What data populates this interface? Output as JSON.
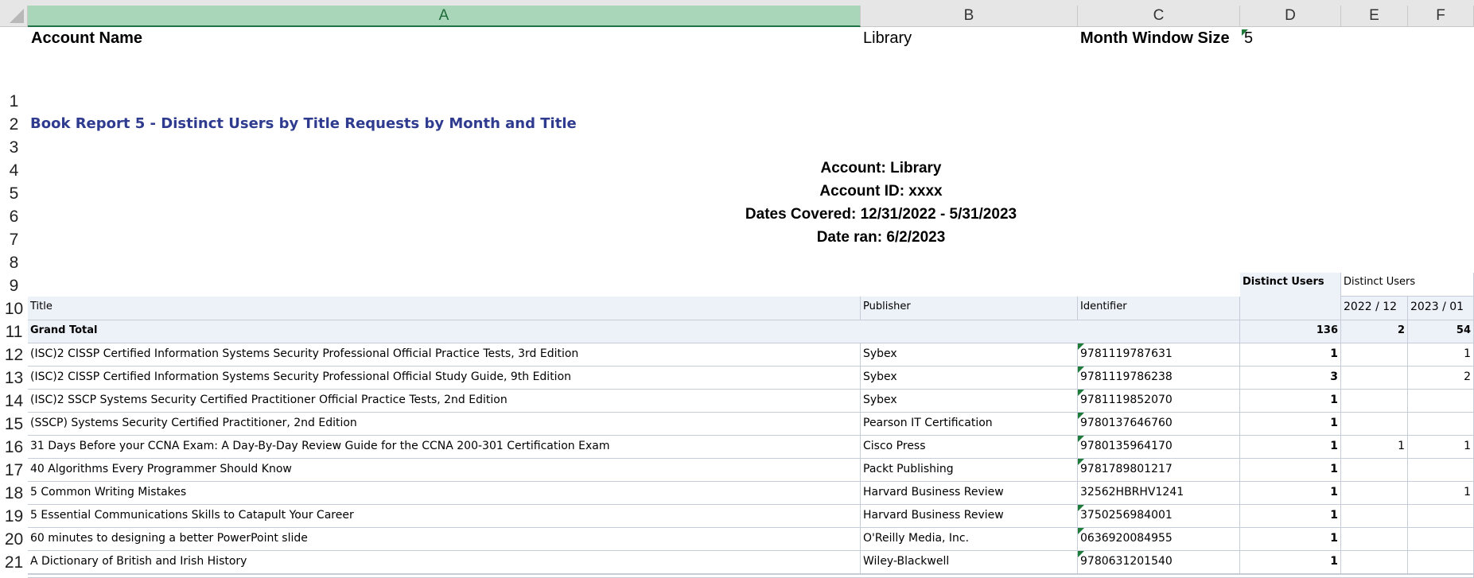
{
  "columns": [
    "A",
    "B",
    "C",
    "D",
    "E",
    "F"
  ],
  "rows": [
    "1",
    "2",
    "3",
    "4",
    "5",
    "6",
    "7",
    "8",
    "9",
    "10",
    "11",
    "12",
    "13",
    "14",
    "15",
    "16",
    "17",
    "18",
    "19",
    "20",
    "21"
  ],
  "header_area": {
    "account_name_label": "Account Name",
    "account_name_value": "Library",
    "month_window_label": "Month Window Size",
    "month_window_value": "5"
  },
  "report_title": "Book Report 5 - Distinct Users by Title Requests by Month and Title",
  "report_info": {
    "account": "Account: Library",
    "account_id": "Account ID: xxxx",
    "dates_covered": "Dates Covered: 12/31/2022 - 5/31/2023",
    "date_ran": "Date ran: 6/2/2023"
  },
  "table": {
    "distinct_users_total_header": "Distinct Users",
    "distinct_users_month_header": "Distinct Users",
    "headers": [
      "Title",
      "Publisher",
      "Identifier"
    ],
    "months": [
      "2022 / 12",
      "2023 / 01"
    ],
    "grand_total": {
      "label": "Grand Total",
      "total": "136",
      "m1": "2",
      "m2": "54"
    },
    "rows": [
      {
        "title": "(ISC)2 CISSP Certified Information Systems Security Professional Official Practice Tests, 3rd Edition",
        "publisher": "Sybex",
        "identifier": "9781119787631",
        "total": "1",
        "m1": "",
        "m2": "1"
      },
      {
        "title": "(ISC)2 CISSP Certified Information Systems Security Professional Official Study Guide, 9th Edition",
        "publisher": "Sybex",
        "identifier": "9781119786238",
        "total": "3",
        "m1": "",
        "m2": "2"
      },
      {
        "title": "(ISC)2 SSCP Systems Security Certified Practitioner Official Practice Tests, 2nd Edition",
        "publisher": "Sybex",
        "identifier": "9781119852070",
        "total": "1",
        "m1": "",
        "m2": ""
      },
      {
        "title": "(SSCP) Systems Security Certified Practitioner, 2nd Edition",
        "publisher": "Pearson IT Certification",
        "identifier": "9780137646760",
        "total": "1",
        "m1": "",
        "m2": ""
      },
      {
        "title": "31 Days Before your CCNA Exam: A Day-By-Day Review Guide for the CCNA 200-301 Certification Exam",
        "publisher": "Cisco Press",
        "identifier": "9780135964170",
        "total": "1",
        "m1": "1",
        "m2": "1"
      },
      {
        "title": "40 Algorithms Every Programmer Should Know",
        "publisher": "Packt Publishing",
        "identifier": "9781789801217",
        "total": "1",
        "m1": "",
        "m2": ""
      },
      {
        "title": "5 Common Writing Mistakes",
        "publisher": "Harvard Business Review",
        "identifier": "32562HBRHV1241",
        "total": "1",
        "m1": "",
        "m2": "1"
      },
      {
        "title": "5 Essential Communications Skills to Catapult Your Career",
        "publisher": "Harvard Business Review",
        "identifier": "3750256984001",
        "total": "1",
        "m1": "",
        "m2": ""
      },
      {
        "title": "60 minutes to designing a better PowerPoint slide",
        "publisher": "O'Reilly Media, Inc.",
        "identifier": "0636920084955",
        "total": "1",
        "m1": "",
        "m2": ""
      },
      {
        "title": "A Dictionary of British and Irish History",
        "publisher": "Wiley-Blackwell",
        "identifier": "9780631201540",
        "total": "1",
        "m1": "",
        "m2": ""
      }
    ]
  }
}
